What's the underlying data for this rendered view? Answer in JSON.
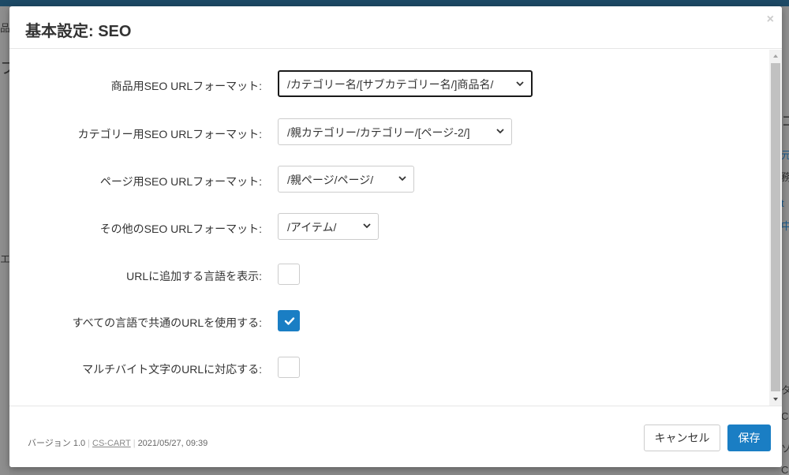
{
  "background": {
    "left_fragments": [
      "品",
      "フ",
      "エ"
    ],
    "right_fragments": [
      "コ",
      "元",
      "務",
      "t",
      "中",
      "タ",
      "C",
      "ソ",
      "CS-Ca"
    ]
  },
  "modal": {
    "title": "基本設定: SEO",
    "close_label": "×",
    "fields": [
      {
        "label": "商品用SEO URLフォーマット:",
        "value": "/カテゴリー名/[サブカテゴリー名/]商品名/"
      },
      {
        "label": "カテゴリー用SEO URLフォーマット:",
        "value": "/親カテゴリー/カテゴリー/[ページ-2/]"
      },
      {
        "label": "ページ用SEO URLフォーマット:",
        "value": "/親ページ/ページ/"
      },
      {
        "label": "その他のSEO URLフォーマット:",
        "value": "/アイテム/"
      }
    ],
    "checkboxes": [
      {
        "label": "URLに追加する言語を表示:",
        "checked": false
      },
      {
        "label": "すべての言語で共通のURLを使用する:",
        "checked": true
      },
      {
        "label": "マルチバイト文字のURLに対応する:",
        "checked": false
      }
    ]
  },
  "footer": {
    "version": "バージョン 1.0",
    "vendor_link": "CS-CART",
    "date": "2021/05/27, 09:39",
    "cancel_label": "キャンセル",
    "save_label": "保存"
  },
  "colors": {
    "accent": "#1a7ec4",
    "topbar": "#1d4a66"
  }
}
